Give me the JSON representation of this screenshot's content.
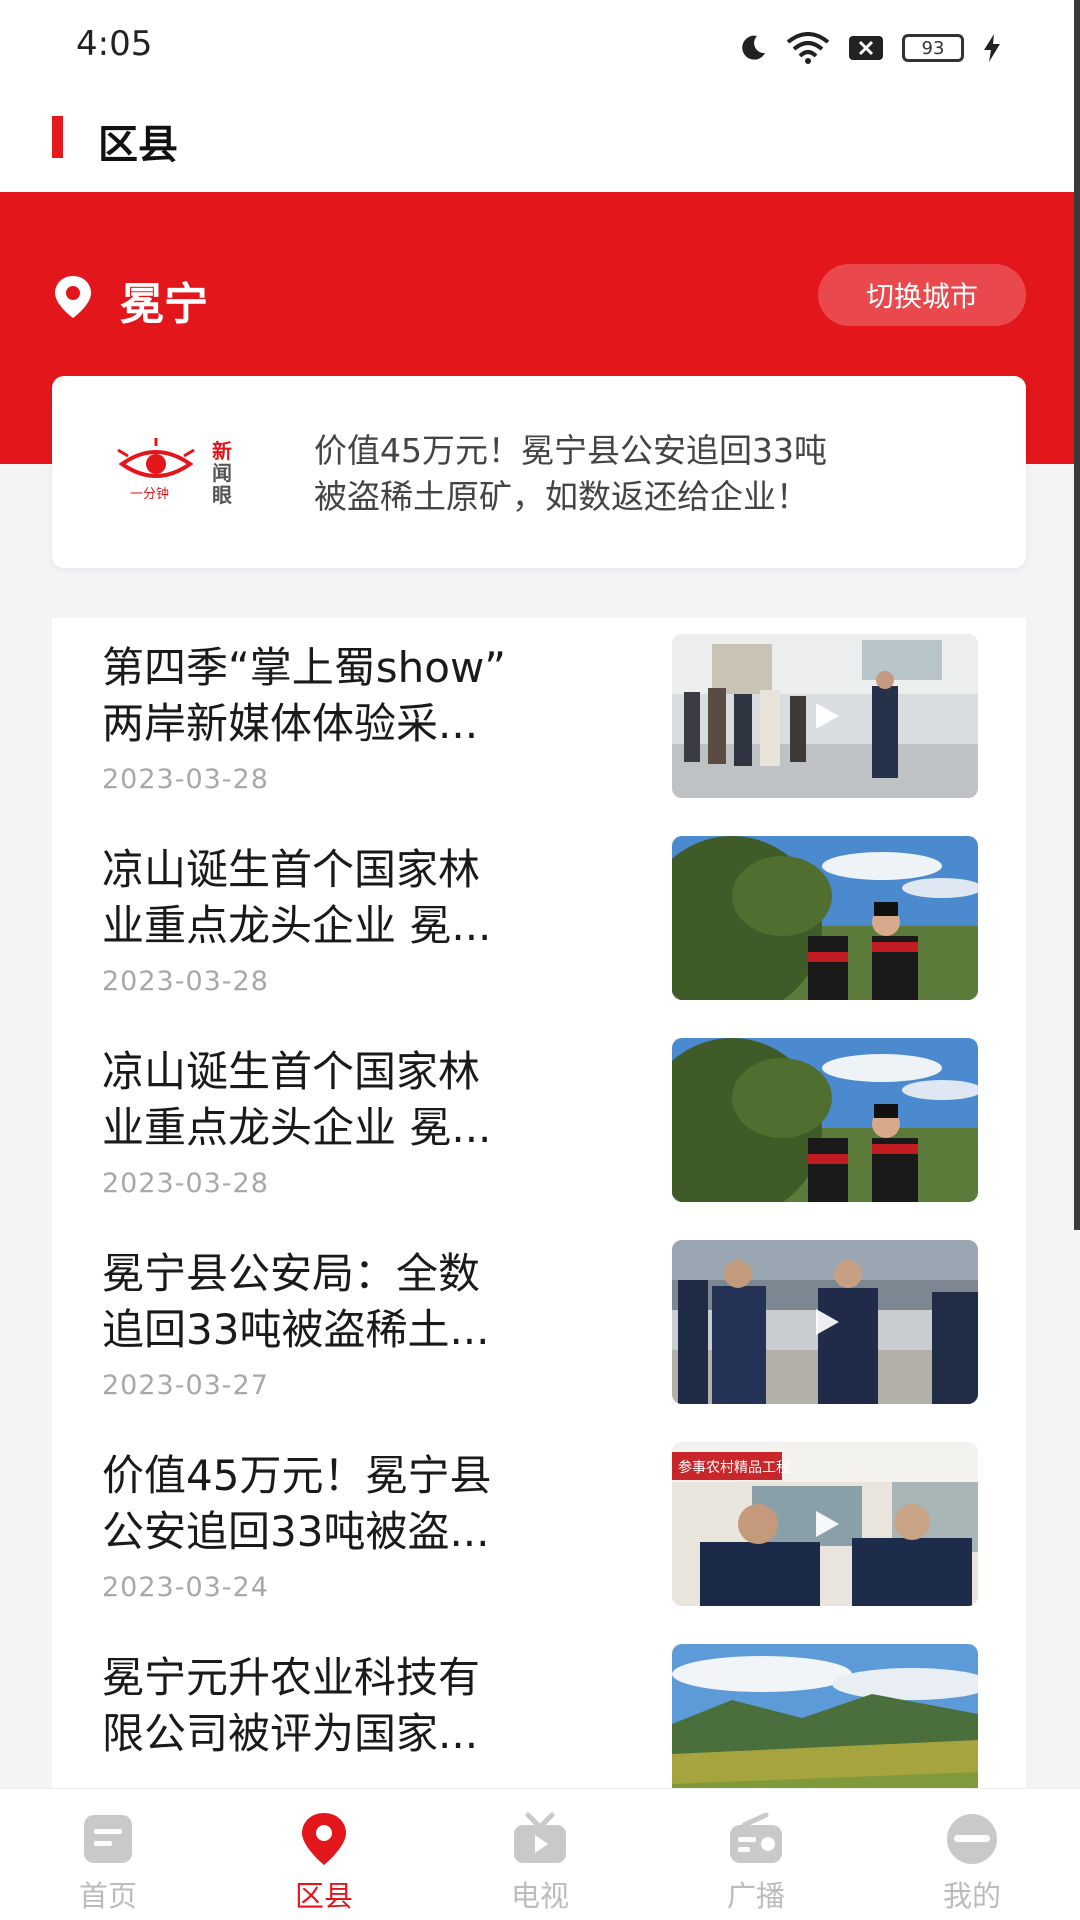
{
  "status_bar": {
    "time": "4:05",
    "battery": "93",
    "icons": [
      "moon-icon",
      "wifi-icon",
      "sim-icon",
      "battery-icon",
      "charging-icon"
    ]
  },
  "header": {
    "title": "区县"
  },
  "location": {
    "city": "冕宁",
    "switch_label": "切换城市",
    "icon": "location-pin-icon"
  },
  "feature": {
    "logo_text": [
      "新",
      "闻",
      "眼"
    ],
    "logo_caption": "一分钟",
    "headline_line1": "价值45万元！冕宁县公安追回33吨",
    "headline_line2": "被盗稀土原矿，如数返还给企业！"
  },
  "news": [
    {
      "line1": "第四季“掌上蜀show”",
      "line2": "两岸新媒体体验采...",
      "date": "2023-03-28",
      "video": true
    },
    {
      "line1": "凉山诞生首个国家林",
      "line2": "业重点龙头企业 冕...",
      "date": "2023-03-28",
      "video": false
    },
    {
      "line1": "凉山诞生首个国家林",
      "line2": "业重点龙头企业 冕...",
      "date": "2023-03-28",
      "video": false
    },
    {
      "line1": "冕宁县公安局：全数",
      "line2": "追回33吨被盗稀土...",
      "date": "2023-03-27",
      "video": true
    },
    {
      "line1": "价值45万元！冕宁县",
      "line2": "公安追回33吨被盗...",
      "date": "2023-03-24",
      "video": true
    },
    {
      "line1": "冕宁元升农业科技有",
      "line2": "限公司被评为国家...",
      "date": "",
      "video": false
    }
  ],
  "thumb_banner": "参事农村精品工程",
  "tabs": [
    {
      "label": "首页",
      "icon": "home-icon",
      "active": false
    },
    {
      "label": "区县",
      "icon": "location-pin-icon",
      "active": true
    },
    {
      "label": "电视",
      "icon": "tv-icon",
      "active": false
    },
    {
      "label": "广播",
      "icon": "radio-icon",
      "active": false
    },
    {
      "label": "我的",
      "icon": "profile-icon",
      "active": false
    }
  ],
  "colors": {
    "brand_red": "#e3171b",
    "tab_inactive": "#bcbcbc",
    "date_gray": "#a8a8a8"
  }
}
